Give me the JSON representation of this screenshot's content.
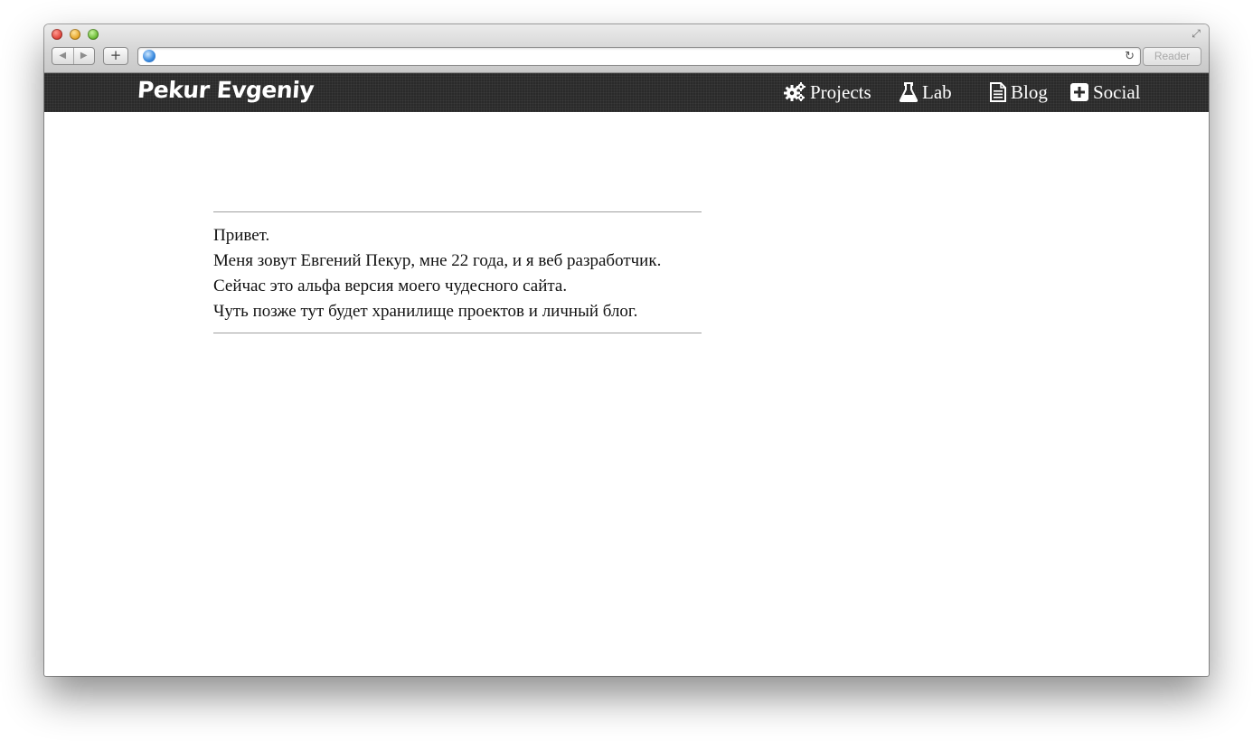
{
  "browser": {
    "back_icon": "back-arrow-icon",
    "forward_icon": "forward-arrow-icon",
    "new_tab_label": "+",
    "address_value": "",
    "reader_label": "Reader"
  },
  "site": {
    "brand": "Pekur Evgeniy",
    "nav": [
      {
        "label": "Projects",
        "icon": "gears-icon"
      },
      {
        "label": "Lab",
        "icon": "flask-icon"
      },
      {
        "label": "Blog",
        "icon": "document-icon"
      },
      {
        "label": "Social",
        "icon": "plus-square-icon"
      }
    ]
  },
  "content": {
    "lines": [
      "Привет.",
      "Меня зовут Евгений Пекур, мне 22 года, и я веб разработчик.",
      "Сейчас это альфа версия моего чудесного сайта.",
      "Чуть позже тут будет хранилище проектов и личный блог."
    ]
  },
  "colors": {
    "topbar": "#2a2a2a",
    "divider": "#a0a0a0",
    "text": "#111111"
  }
}
